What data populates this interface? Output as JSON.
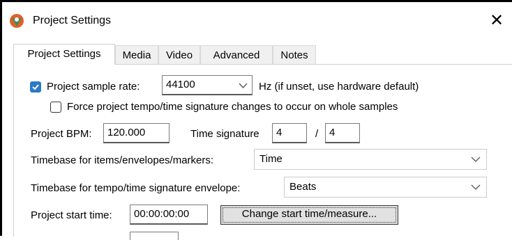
{
  "window": {
    "title": "Project Settings"
  },
  "tabs": [
    {
      "label": "Project Settings",
      "active": true
    },
    {
      "label": "Media"
    },
    {
      "label": "Video"
    },
    {
      "label": "Advanced"
    },
    {
      "label": "Notes"
    }
  ],
  "sample_rate": {
    "checkbox_label": "Project sample rate:",
    "checked": true,
    "value": "44100",
    "hint": "Hz (if unset, use hardware default)"
  },
  "force_tempo": {
    "label": "Force project tempo/time signature changes to occur on whole samples",
    "checked": false
  },
  "bpm": {
    "label": "Project BPM:",
    "value": "120.000"
  },
  "time_signature": {
    "label": "Time signature",
    "numerator": "4",
    "separator": "/",
    "denominator": "4"
  },
  "timebase_items": {
    "label": "Timebase for items/envelopes/markers:",
    "value": "Time"
  },
  "timebase_tempo": {
    "label": "Timebase for tempo/time signature envelope:",
    "value": "Beats"
  },
  "start_time": {
    "label": "Project start time:",
    "value": "00:00:00:00",
    "button_label": "Change start time/measure..."
  },
  "colors": {
    "accent": "#2b79c9",
    "icon_orange": "#e0622a",
    "icon_green": "#3c8d5a"
  },
  "icons": [
    "reaper-logo-icon",
    "close-icon",
    "checkmark-icon",
    "chevron-down-icon"
  ]
}
